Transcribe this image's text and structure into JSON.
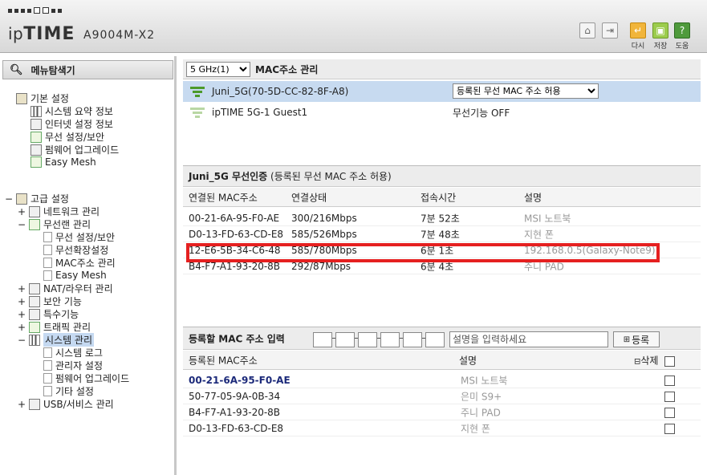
{
  "header": {
    "brand_prefix": "ip",
    "brand_main": "TIME",
    "model": "A9004M-X2",
    "buttons": [
      {
        "icon": "home-icon"
      },
      {
        "icon": "logout-icon"
      },
      {
        "icon": "reload-icon",
        "label": "다시"
      },
      {
        "icon": "save-icon",
        "label": "저장"
      },
      {
        "icon": "help-icon",
        "label": "도움"
      }
    ]
  },
  "sidebar": {
    "title": "메뉴탐색기",
    "basic": {
      "label": "기본 설정",
      "items": [
        "시스템 요약 정보",
        "인터넷 설정 정보",
        "무선 설정/보안",
        "펌웨어 업그레이드",
        "Easy Mesh"
      ]
    },
    "advanced": {
      "label": "고급 설정",
      "items": [
        {
          "toggle": "+",
          "label": "네트워크 관리"
        },
        {
          "toggle": "−",
          "label": "무선랜 관리",
          "children": [
            "무선 설정/보안",
            "무선확장설정",
            "MAC주소 관리",
            "Easy Mesh"
          ]
        },
        {
          "toggle": "+",
          "label": "NAT/라우터 관리"
        },
        {
          "toggle": "+",
          "label": "보안 기능"
        },
        {
          "toggle": "+",
          "label": "특수기능"
        },
        {
          "toggle": "+",
          "label": "트래픽 관리"
        },
        {
          "toggle": "−",
          "label": "시스템 관리",
          "children": [
            "시스템 로그",
            "관리자 설정",
            "펌웨어 업그레이드",
            "기타 설정"
          ]
        },
        {
          "toggle": "+",
          "label": "USB/서비스 관리"
        }
      ]
    }
  },
  "main": {
    "band_select": "5 GHz(1)",
    "title": "MAC주소 관리",
    "ssids": [
      {
        "name": "Juni_5G(70-5D-CC-82-8F-A8)",
        "value": "등록된 무선 MAC 주소 허용",
        "active": true
      },
      {
        "name": "ipTIME 5G-1 Guest1",
        "value": "무선기능 OFF",
        "active": false
      }
    ],
    "auth_section": {
      "title_bold": "Juni_5G 무선인증",
      "title_rest": "(등록된 무선 MAC 주소 허용)",
      "columns": [
        "연결된 MAC주소",
        "연결상태",
        "접속시간",
        "설명"
      ],
      "rows": [
        [
          "00-21-6A-95-F0-AE",
          "300/216Mbps",
          "7분 52초",
          "MSI 노트북"
        ],
        [
          "D0-13-FD-63-CD-E8",
          "585/526Mbps",
          "7분 48초",
          "지현 폰"
        ],
        [
          "12-E6-5B-34-C6-48",
          "585/780Mbps",
          "6분 1초",
          "192.168.0.5(Galaxy-Note9)"
        ],
        [
          "B4-F7-A1-93-20-8B",
          "292/87Mbps",
          "6분 4초",
          "주니 PAD"
        ]
      ]
    },
    "register": {
      "title": "등록할 MAC 주소 입력",
      "desc_placeholder": "설명을 입력하세요",
      "add_label": "등록",
      "columns": [
        "등록된 MAC주소",
        "설명",
        "삭제"
      ],
      "rows": [
        [
          "00-21-6A-95-F0-AE",
          "MSI 노트북"
        ],
        [
          "50-77-05-9A-0B-34",
          "은미 S9+"
        ],
        [
          "B4-F7-A1-93-20-8B",
          "주니 PAD"
        ],
        [
          "D0-13-FD-63-CD-E8",
          "지현 폰"
        ]
      ]
    }
  },
  "colors": {
    "highlight_border": "#e52020",
    "active_row": "#c7daf0",
    "wifi_green": "#4c9a2a"
  }
}
